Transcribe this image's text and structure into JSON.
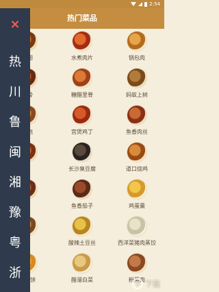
{
  "status_bar": {
    "time": "2:54"
  },
  "app_bar": {
    "title": "热门菜品"
  },
  "drawer": {
    "close_glyph": "×",
    "items": [
      "热",
      "川",
      "鲁",
      "闽",
      "湘",
      "豫",
      "粤",
      "浙"
    ]
  },
  "dishes": [
    {
      "name": "鸡翅",
      "colors": [
        "#7a3a12",
        "#c9772a",
        "#f2d9a6"
      ]
    },
    {
      "name": "水煮肉片",
      "colors": [
        "#a52d14",
        "#e26a2c",
        "#f3e3c8"
      ]
    },
    {
      "name": "锅包肉",
      "colors": [
        "#b46b1e",
        "#e7a44b",
        "#f7e8c9"
      ]
    },
    {
      "name": "排骨",
      "colors": [
        "#6a2a10",
        "#b05a24",
        "#efd7b0"
      ]
    },
    {
      "name": "糖醋里脊",
      "colors": [
        "#a0401a",
        "#d97a35",
        "#f6e4c5"
      ]
    },
    {
      "name": "蚂蚁上树",
      "colors": [
        "#7a4a1a",
        "#b27a3c",
        "#eedcb8"
      ]
    },
    {
      "name": "筋泡",
      "colors": [
        "#8a4a1e",
        "#c98a42",
        "#f2dfbe"
      ]
    },
    {
      "name": "宫煲鸡丁",
      "colors": [
        "#9a2a12",
        "#d45a28",
        "#f4e1c3"
      ]
    },
    {
      "name": "鱼香肉丝",
      "colors": [
        "#8a3016",
        "#c86a34",
        "#f1dcb9"
      ]
    },
    {
      "name": "肉",
      "colors": [
        "#7b3312",
        "#c0743a",
        "#f0dab5"
      ]
    },
    {
      "name": "长沙臭豆腐",
      "colors": [
        "#2a2420",
        "#5a4a3c",
        "#e9dcc4"
      ]
    },
    {
      "name": "道口烧鸡",
      "colors": [
        "#9a4a16",
        "#d98a3a",
        "#f5e2c0"
      ]
    },
    {
      "name": "墙",
      "colors": [
        "#6d2d14",
        "#a8623a",
        "#eed8b4"
      ]
    },
    {
      "name": "鱼香茄子",
      "colors": [
        "#5a2a1a",
        "#9a4a2a",
        "#efd8b6"
      ]
    },
    {
      "name": "鸡蛋羹",
      "colors": [
        "#d69a2a",
        "#f2c64a",
        "#fbeccb"
      ]
    },
    {
      "name": "面",
      "colors": [
        "#7a4a22",
        "#c48a4e",
        "#f3e1c2"
      ]
    },
    {
      "name": "酸辣土豆丝",
      "colors": [
        "#b8861e",
        "#e8c04a",
        "#f9ebc8"
      ]
    },
    {
      "name": "西洋菜猪肉蒸饺",
      "colors": [
        "#c8c2a6",
        "#e8e2c8",
        "#f7f1dd"
      ]
    },
    {
      "name": "南瓜饼",
      "colors": [
        "#d98a1e",
        "#f0b44a",
        "#fbe8c4"
      ]
    },
    {
      "name": "醋溜白菜",
      "colors": [
        "#c99a4a",
        "#e8c880",
        "#f9edd0"
      ]
    },
    {
      "name": "粉蒸肉",
      "colors": [
        "#8a4a24",
        "#c47a48",
        "#f3dfc0"
      ]
    }
  ],
  "watermark": {
    "logo": "下",
    "text": "下载"
  }
}
